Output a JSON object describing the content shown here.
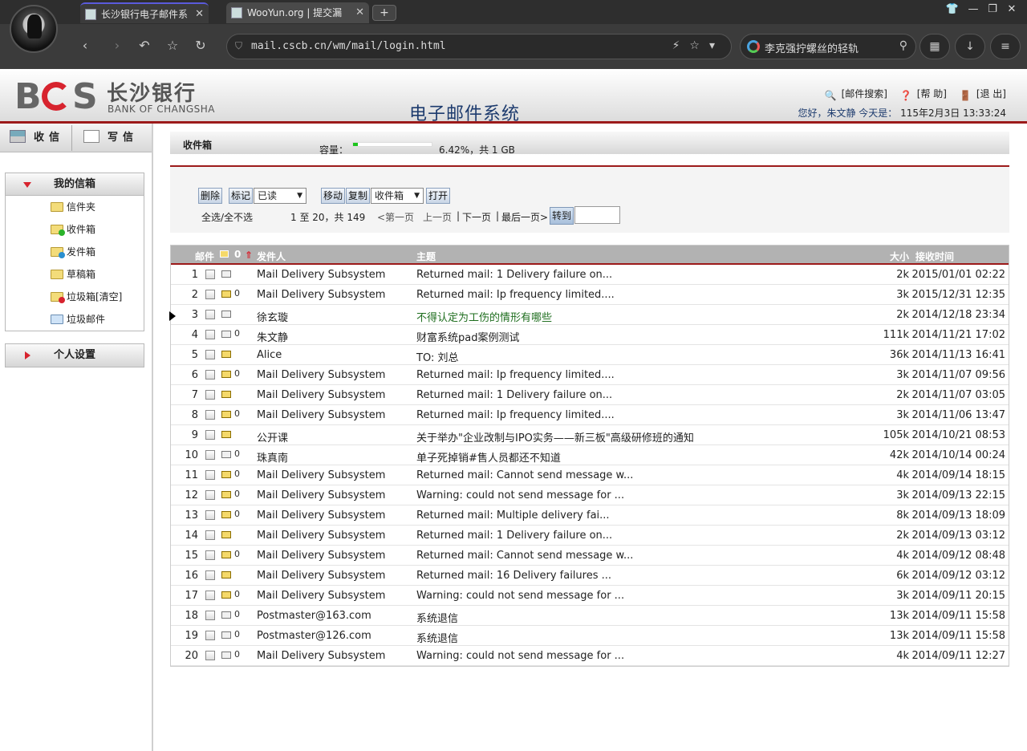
{
  "browser": {
    "tabs": [
      {
        "title": "长沙银行电子邮件系"
      },
      {
        "title": "WooYun.org | 提交漏"
      }
    ],
    "url": "mail.cscb.cn/wm/mail/login.html",
    "search_text": "李克强拧螺丝的轻轨"
  },
  "header": {
    "logo_cn": "长沙银行",
    "logo_en": "BANK OF CHANGSHA",
    "logo_letters": "BCS",
    "system_title": "电子邮件系统",
    "links": {
      "search": "[邮件搜索]",
      "help": "[帮 助]",
      "logout": "[退 出]"
    },
    "greeting": "您好，朱文静 今天是：",
    "date": "115年2月3日 13:33:24"
  },
  "sidebar": {
    "receive_label": "收信",
    "write_label": "写信",
    "my_mail_title": "我的信箱",
    "folders": [
      {
        "label": "信件夹"
      },
      {
        "label": "收件箱"
      },
      {
        "label": "发件箱"
      },
      {
        "label": "草稿箱"
      },
      {
        "label": "垃圾箱[清空]"
      },
      {
        "label": "垃圾邮件"
      }
    ],
    "settings_title": "个人设置"
  },
  "main": {
    "title": "收件箱",
    "capacity_label": "容量：",
    "capacity_fraction": 0.0642,
    "capacity_text": "6.42%，共 1 GB",
    "toolbar": {
      "delete": "删除",
      "mark": "标记",
      "mark_value": "已读",
      "move": "移动",
      "copy": "复制",
      "folder_value": "收件箱",
      "open": "打开",
      "select_all": "全选/全不选",
      "range": "1 至 20，共 149",
      "first": "<第一页",
      "prev": "上一页",
      "sep1": "|",
      "next": "下一页",
      "sep2": "|",
      "last": "最后一页>",
      "goto": "转到"
    },
    "columns": {
      "mail": "邮件",
      "sender": "发件人",
      "subject": "主题",
      "size": "大小",
      "time": "接收时间"
    },
    "emails": [
      {
        "num": "1",
        "read": true,
        "attach": false,
        "sender": "Mail Delivery Subsystem",
        "subject": "Returned mail: 1 Delivery failure on...",
        "size": "2k",
        "time": "2015/01/01 02:22"
      },
      {
        "num": "2",
        "read": false,
        "attach": true,
        "sender": "Mail Delivery Subsystem",
        "subject": "Returned mail: Ip frequency limited....",
        "size": "3k",
        "time": "2015/12/31 12:35"
      },
      {
        "num": "3",
        "read": true,
        "attach": false,
        "sender": "徐玄璇",
        "subject": "不得认定为工伤的情形有哪些",
        "size": "2k",
        "time": "2014/12/18 23:34"
      },
      {
        "num": "4",
        "read": true,
        "attach": true,
        "sender": "朱文静",
        "subject": "财富系统pad案例测试",
        "size": "111k",
        "time": "2014/11/21 17:02"
      },
      {
        "num": "5",
        "read": false,
        "attach": false,
        "sender": "Alice",
        "subject": "TO: 刘总",
        "size": "36k",
        "time": "2014/11/13 16:41"
      },
      {
        "num": "6",
        "read": false,
        "attach": true,
        "sender": "Mail Delivery Subsystem",
        "subject": "Returned mail: Ip frequency limited....",
        "size": "3k",
        "time": "2014/11/07 09:56"
      },
      {
        "num": "7",
        "read": false,
        "attach": false,
        "sender": "Mail Delivery Subsystem",
        "subject": "Returned mail: 1 Delivery failure on...",
        "size": "2k",
        "time": "2014/11/07 03:05"
      },
      {
        "num": "8",
        "read": false,
        "attach": true,
        "sender": "Mail Delivery Subsystem",
        "subject": "Returned mail: Ip frequency limited....",
        "size": "3k",
        "time": "2014/11/06 13:47"
      },
      {
        "num": "9",
        "read": false,
        "attach": false,
        "sender": "公开课",
        "subject": "关于举办\"企业改制与IPO实务——新三板\"高级研修班的通知",
        "size": "105k",
        "time": "2014/10/21 08:53"
      },
      {
        "num": "10",
        "read": true,
        "attach": true,
        "sender": "珠真南",
        "subject": "单子死掉销#售人员都还不知道",
        "size": "42k",
        "time": "2014/10/14 00:24"
      },
      {
        "num": "11",
        "read": false,
        "attach": true,
        "sender": "Mail Delivery Subsystem",
        "subject": "Returned mail: Cannot send message w...",
        "size": "4k",
        "time": "2014/09/14 18:15"
      },
      {
        "num": "12",
        "read": false,
        "attach": true,
        "sender": "Mail Delivery Subsystem",
        "subject": "Warning: could not send message for ...",
        "size": "3k",
        "time": "2014/09/13 22:15"
      },
      {
        "num": "13",
        "read": false,
        "attach": true,
        "sender": "Mail Delivery Subsystem",
        "subject": "Returned mail: Multiple delivery fai...",
        "size": "8k",
        "time": "2014/09/13 18:09"
      },
      {
        "num": "14",
        "read": false,
        "attach": false,
        "sender": "Mail Delivery Subsystem",
        "subject": "Returned mail: 1 Delivery failure on...",
        "size": "2k",
        "time": "2014/09/13 03:12"
      },
      {
        "num": "15",
        "read": false,
        "attach": true,
        "sender": "Mail Delivery Subsystem",
        "subject": "Returned mail: Cannot send message w...",
        "size": "4k",
        "time": "2014/09/12 08:48"
      },
      {
        "num": "16",
        "read": false,
        "attach": false,
        "sender": "Mail Delivery Subsystem",
        "subject": "Returned mail: 16 Delivery failures ...",
        "size": "6k",
        "time": "2014/09/12 03:12"
      },
      {
        "num": "17",
        "read": false,
        "attach": true,
        "sender": "Mail Delivery Subsystem",
        "subject": "Warning: could not send message for ...",
        "size": "3k",
        "time": "2014/09/11 20:15"
      },
      {
        "num": "18",
        "read": true,
        "attach": true,
        "sender": "Postmaster@163.com",
        "subject": "系统退信",
        "size": "13k",
        "time": "2014/09/11 15:58"
      },
      {
        "num": "19",
        "read": true,
        "attach": true,
        "sender": "Postmaster@126.com",
        "subject": "系统退信",
        "size": "13k",
        "time": "2014/09/11 15:58"
      },
      {
        "num": "20",
        "read": true,
        "attach": true,
        "sender": "Mail Delivery Subsystem",
        "subject": "Warning: could not send message for ...",
        "size": "4k",
        "time": "2014/09/11 12:27"
      }
    ]
  }
}
